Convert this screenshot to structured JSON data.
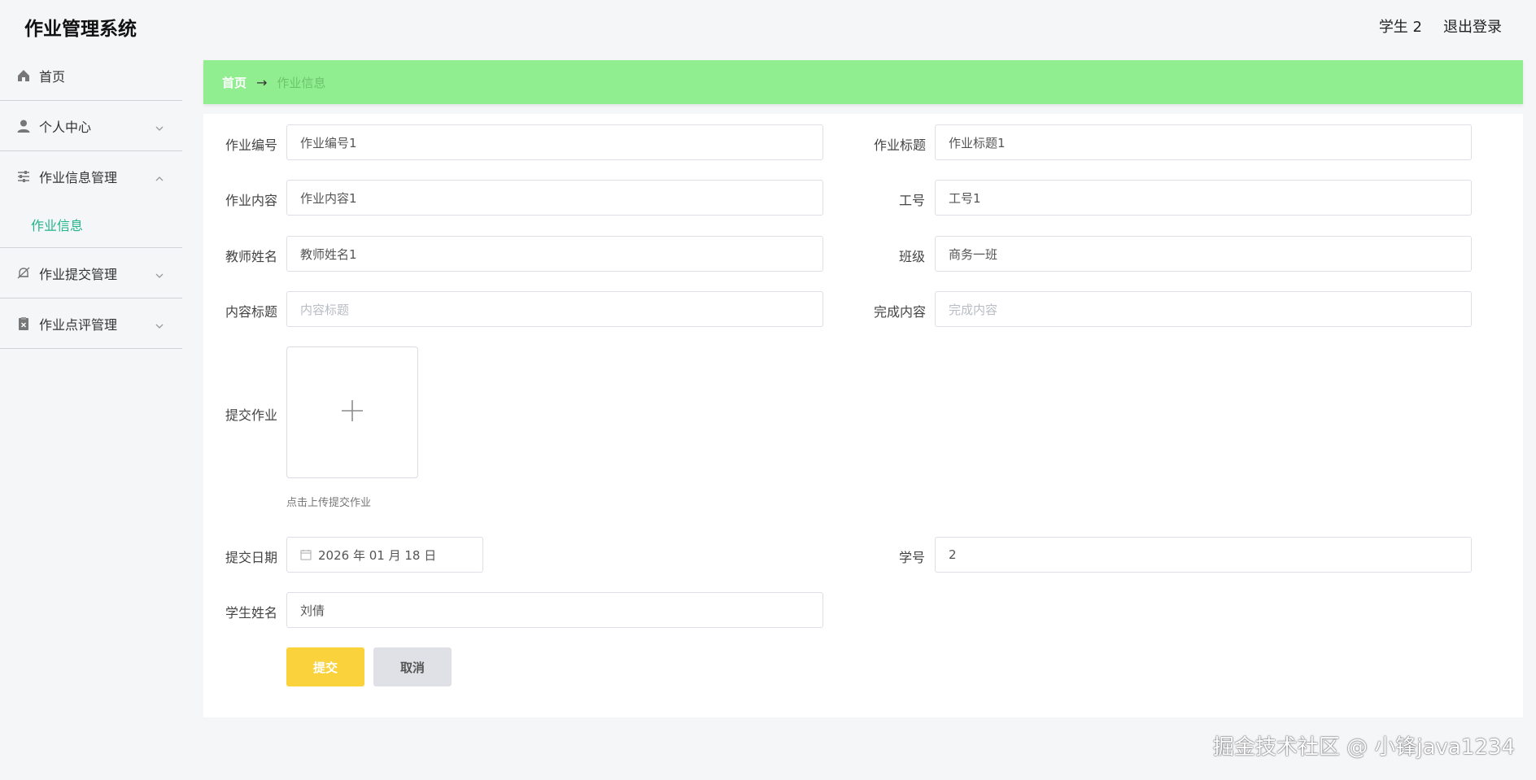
{
  "app": {
    "title": "作业管理系统"
  },
  "header": {
    "user": "学生 2",
    "logout": "退出登录"
  },
  "sidebar": {
    "items": [
      {
        "label": "首页",
        "icon": "home-icon"
      },
      {
        "label": "个人中心",
        "icon": "person-icon"
      },
      {
        "label": "作业信息管理",
        "icon": "sliders-icon",
        "expanded": true,
        "children": [
          {
            "label": "作业信息"
          }
        ]
      },
      {
        "label": "作业提交管理",
        "icon": "bell-off-icon"
      },
      {
        "label": "作业点评管理",
        "icon": "clipboard-x-icon"
      }
    ]
  },
  "breadcrumb": {
    "home": "首页",
    "arrow": "→",
    "current": "作业信息"
  },
  "form": {
    "homework_no": {
      "label": "作业编号",
      "value": "作业编号1"
    },
    "homework_title": {
      "label": "作业标题",
      "value": "作业标题1"
    },
    "homework_content": {
      "label": "作业内容",
      "value": "作业内容1"
    },
    "staff_no": {
      "label": "工号",
      "value": "工号1"
    },
    "teacher_name": {
      "label": "教师姓名",
      "value": "教师姓名1"
    },
    "class": {
      "label": "班级",
      "value": "商务一班"
    },
    "content_title": {
      "label": "内容标题",
      "placeholder": "内容标题"
    },
    "completed_content": {
      "label": "完成内容",
      "placeholder": "完成内容"
    },
    "upload": {
      "label": "提交作业",
      "tip": "点击上传提交作业"
    },
    "submit_date": {
      "label": "提交日期",
      "value": "2026 年 01 月 18 日"
    },
    "student_no": {
      "label": "学号",
      "value": "2"
    },
    "student_name": {
      "label": "学生姓名",
      "value": "刘倩"
    },
    "submit_button": "提交",
    "cancel_button": "取消"
  },
  "watermark": "掘金技术社区 @ 小锋java1234"
}
